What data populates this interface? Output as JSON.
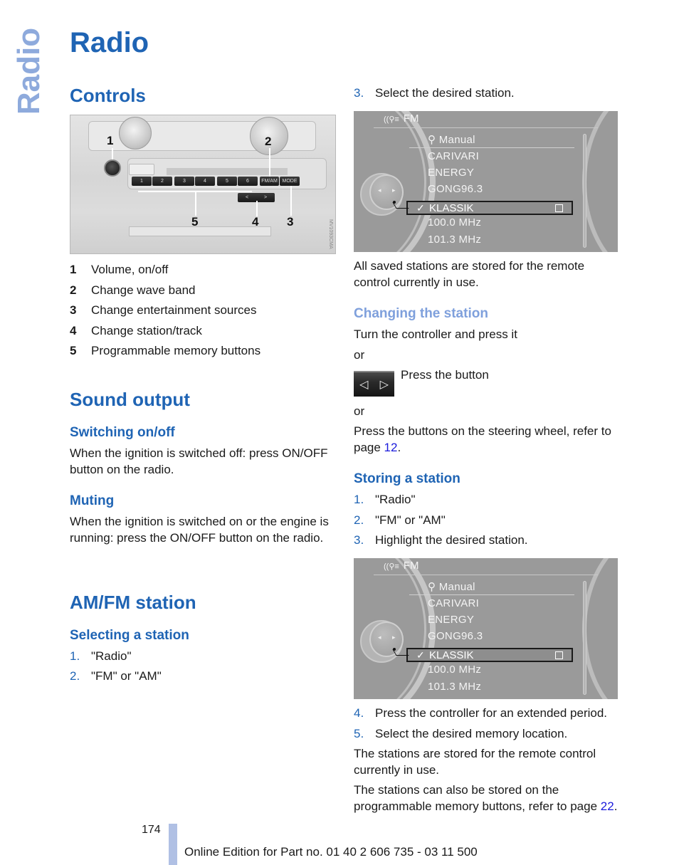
{
  "side_tab": "Radio",
  "title": "Radio",
  "left": {
    "controls_heading": "Controls",
    "panel": {
      "callouts": [
        "1",
        "2",
        "3",
        "4",
        "5"
      ],
      "preset_buttons": [
        "1",
        "2",
        "3",
        "4",
        "5",
        "6"
      ],
      "fm_am_label": "FM/AM",
      "mode_label": "MODE",
      "seek_labels": [
        "<",
        ">"
      ],
      "image_code": "MV1093CMA"
    },
    "legend": [
      {
        "num": "1",
        "text": "Volume, on/off"
      },
      {
        "num": "2",
        "text": "Change wave band"
      },
      {
        "num": "3",
        "text": "Change entertainment sources"
      },
      {
        "num": "4",
        "text": "Change station/track"
      },
      {
        "num": "5",
        "text": "Programmable memory buttons"
      }
    ],
    "sound_output_heading": "Sound output",
    "switching_heading": "Switching on/off",
    "switching_text": "When the ignition is switched off: press ON/OFF button on the radio.",
    "muting_heading": "Muting",
    "muting_text": "When the ignition is switched on or the engine is running: press the ON/OFF button on the radio.",
    "amfm_heading": "AM/FM station",
    "selecting_heading": "Selecting a station",
    "selecting_steps": [
      {
        "num": "1.",
        "text": "\"Radio\""
      },
      {
        "num": "2.",
        "text": "\"FM\" or \"AM\""
      }
    ]
  },
  "right": {
    "select_step": {
      "num": "3.",
      "text": "Select the desired station."
    },
    "screen": {
      "band": "FM",
      "band_icon": "radio-antenna-icon",
      "manual_label": "Manual",
      "stations": [
        "CARIVARI",
        "ENERGY",
        "GONG96.3",
        "KLASSIK",
        "100.0  MHz",
        "101.3  MHz"
      ],
      "selected_station": "KLASSIK",
      "check": "✓",
      "controller_arrows": [
        "◂",
        "▸"
      ]
    },
    "saved_text": "All saved stations are stored for the remote control currently in use.",
    "changing_heading": "Changing the station",
    "changing_text1": "Turn the controller and press it",
    "or1": "or",
    "press_button_text": "Press the button",
    "arrow_button_glyphs": [
      "◁",
      "▷"
    ],
    "or2": "or",
    "steering_text_before": "Press the buttons on the steering wheel, refer to page ",
    "steering_page_link": "12",
    "steering_text_after": ".",
    "storing_heading": "Storing a station",
    "storing_steps": [
      {
        "num": "1.",
        "text": "\"Radio\""
      },
      {
        "num": "2.",
        "text": "\"FM\" or \"AM\""
      },
      {
        "num": "3.",
        "text": "Highlight the desired station."
      }
    ],
    "storing_steps_after": [
      {
        "num": "4.",
        "text": "Press the controller for an extended period."
      },
      {
        "num": "5.",
        "text": "Select the desired memory location."
      }
    ],
    "stored_text": "The stations are stored for the remote control currently in use.",
    "programmable_text_before": "The stations can also be stored on the programmable memory buttons, refer to page ",
    "programmable_page_link": "22",
    "programmable_text_after": "."
  },
  "footer": {
    "page_number": "174",
    "edition_text": "Online Edition for Part no. 01 40 2 606 735 - 03 11 500"
  },
  "colors": {
    "heading_blue": "#1f64b4",
    "light_heading_blue": "#7fa0dc",
    "side_tab_blue": "#8eaadc",
    "link_blue": "#1a1adc",
    "footer_bar": "#b0c0e4"
  }
}
